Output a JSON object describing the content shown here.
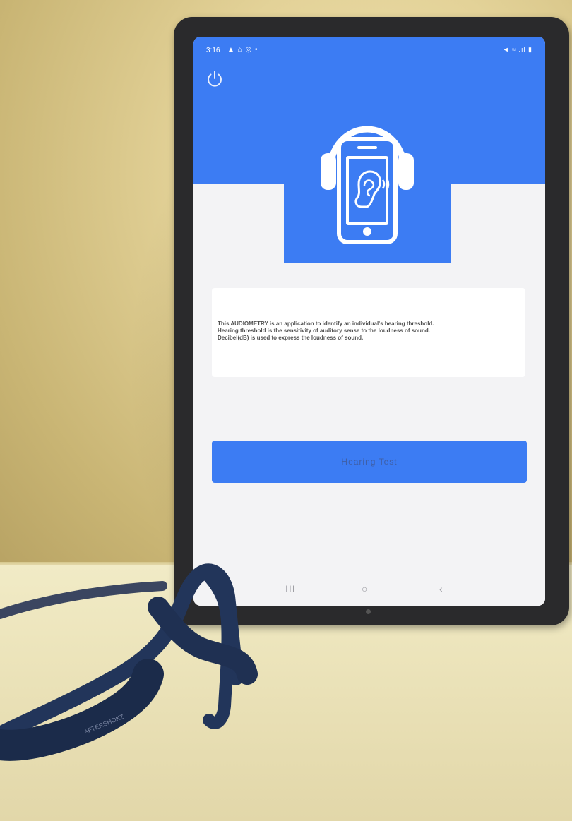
{
  "status_bar": {
    "time": "3:16",
    "left_icons": "▲ ⌂ ◎ •",
    "right_icons": "◄ ≈ .ıl ▮"
  },
  "app": {
    "description_lines": [
      "This AUDIOMETRY is an application to identify an individual's hearing threshold.",
      "Hearing threshold is the sensitivity of auditory sense to the loudness of sound.",
      "Decibel(dB) is used to express the loudness of sound."
    ],
    "hearing_test_label": "Hearing Test"
  },
  "nav": {
    "recent": "III",
    "home": "○",
    "back": "‹"
  },
  "headphones": {
    "brand": "AFTERSHOKZ"
  },
  "colors": {
    "app_blue": "#3c7cf3",
    "screen_bg": "#f3f3f5",
    "headphone_blue": "#22355a"
  },
  "icons": [
    "power-icon",
    "ear-phone-headphones-logo",
    "recent-apps-icon",
    "home-icon",
    "back-icon"
  ]
}
